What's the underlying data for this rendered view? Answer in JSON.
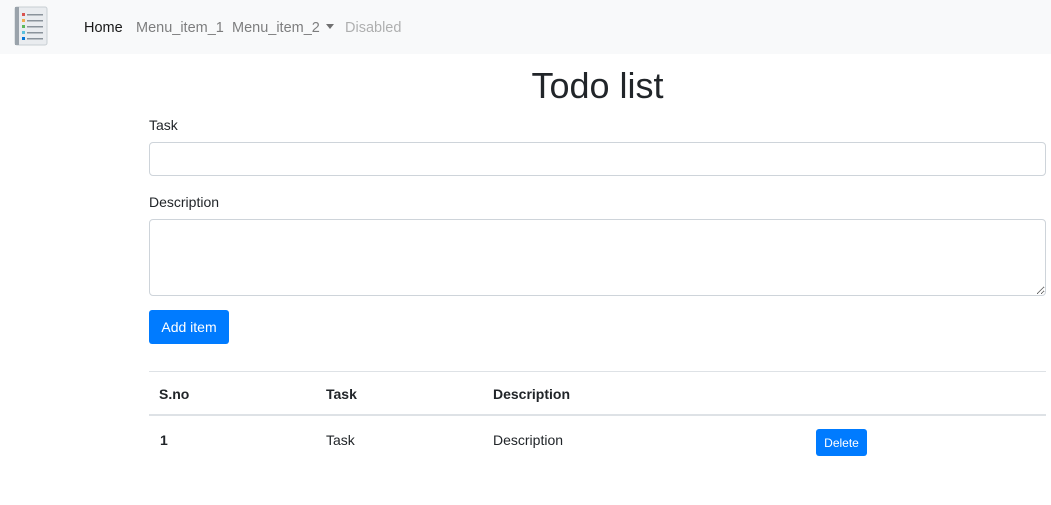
{
  "navbar": {
    "brand_icon": "todo-list-icon",
    "items": [
      {
        "label": "Home",
        "state": "active"
      },
      {
        "label": "Menu_item_1",
        "state": "normal"
      },
      {
        "label": "Menu_item_2",
        "state": "dropdown"
      },
      {
        "label": "Disabled",
        "state": "disabled"
      }
    ]
  },
  "main": {
    "title": "Todo list",
    "task_label": "Task",
    "task_value": "",
    "description_label": "Description",
    "description_value": "",
    "add_button_label": "Add item"
  },
  "table": {
    "headers": [
      "S.no",
      "Task",
      "Description"
    ],
    "rows": [
      {
        "sno": "1",
        "task": "Task",
        "description": "Description",
        "action_label": "Delete"
      }
    ]
  },
  "colors": {
    "primary": "#007bff",
    "navbar_bg": "#f8f9fa",
    "border": "#dee2e6"
  }
}
